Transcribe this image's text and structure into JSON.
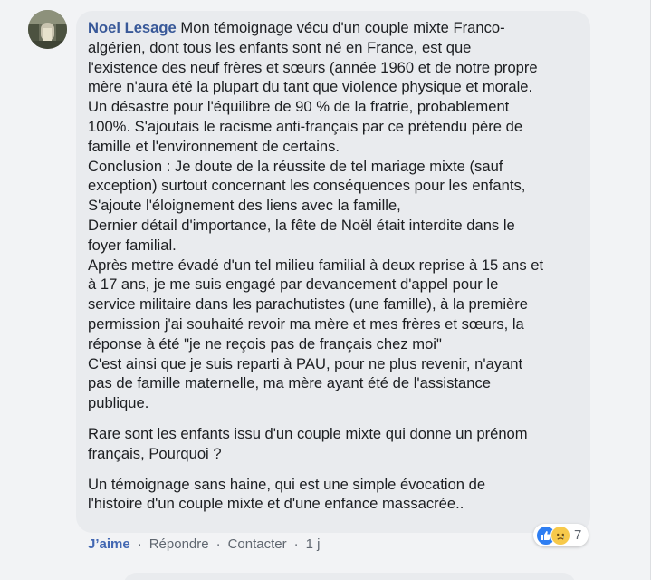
{
  "comment": {
    "author": "Noel Lesage",
    "paragraphs": [
      "Mon témoignage vécu d'un couple mixte Franco-\nalgérien, dont tous les enfants sont né en France, est que\nl'existence des neuf frères et sœurs (année 1960 et de notre propre\nmère n'aura été la plupart du tant que violence physique et morale.\nUn désastre pour l'équilibre de 90 % de la fratrie, probablement\n100%. S'ajoutais le racisme anti-français par ce prétendu père de\nfamille et l'environnement de certains.\nConclusion : Je doute de la réussite de tel mariage mixte (sauf\nexception) surtout concernant les conséquences pour les enfants,\nS'ajoute l'éloignement des liens avec la famille,\nDernier détail d'importance, la fête de Noël était interdite dans le\nfoyer familial.\nAprès mettre évadé d'un tel milieu familial à deux reprise à 15 ans et\nà 17 ans, je me suis engagé par devancement d'appel pour le\nservice militaire dans les parachutistes (une famille), à la première\npermission j'ai souhaité revoir ma mère et mes frères et sœurs, la\nréponse à été \"je ne reçois pas de français chez moi\"\nC'est ainsi que je suis reparti à PAU, pour ne plus revenir, n'ayant\npas de famille maternelle, ma mère ayant été de l'assistance\npublique.",
      "Rare sont les enfants issu d'un couple mixte qui donne un prénom\nfrançais, Pourquoi ?",
      "Un témoignage sans haine, qui est une simple évocation de\nl'histoire d'un couple mixte et d'une enfance massacrée.."
    ]
  },
  "reactions": {
    "icons": [
      "like-icon",
      "sad-icon"
    ],
    "count": "7",
    "colors": {
      "like": "#2e7ef2",
      "sad": "#f7c94a"
    }
  },
  "actions": {
    "like_label": "J’aime",
    "reply_label": "Répondre",
    "contact_label": "Contacter",
    "separator": "·",
    "timestamp": "1 j"
  },
  "theme": {
    "background": "#f2f3f5",
    "bubble": "#e9ebee",
    "author_color": "#385898",
    "link_color": "#4267b2",
    "muted_text": "#606770"
  }
}
